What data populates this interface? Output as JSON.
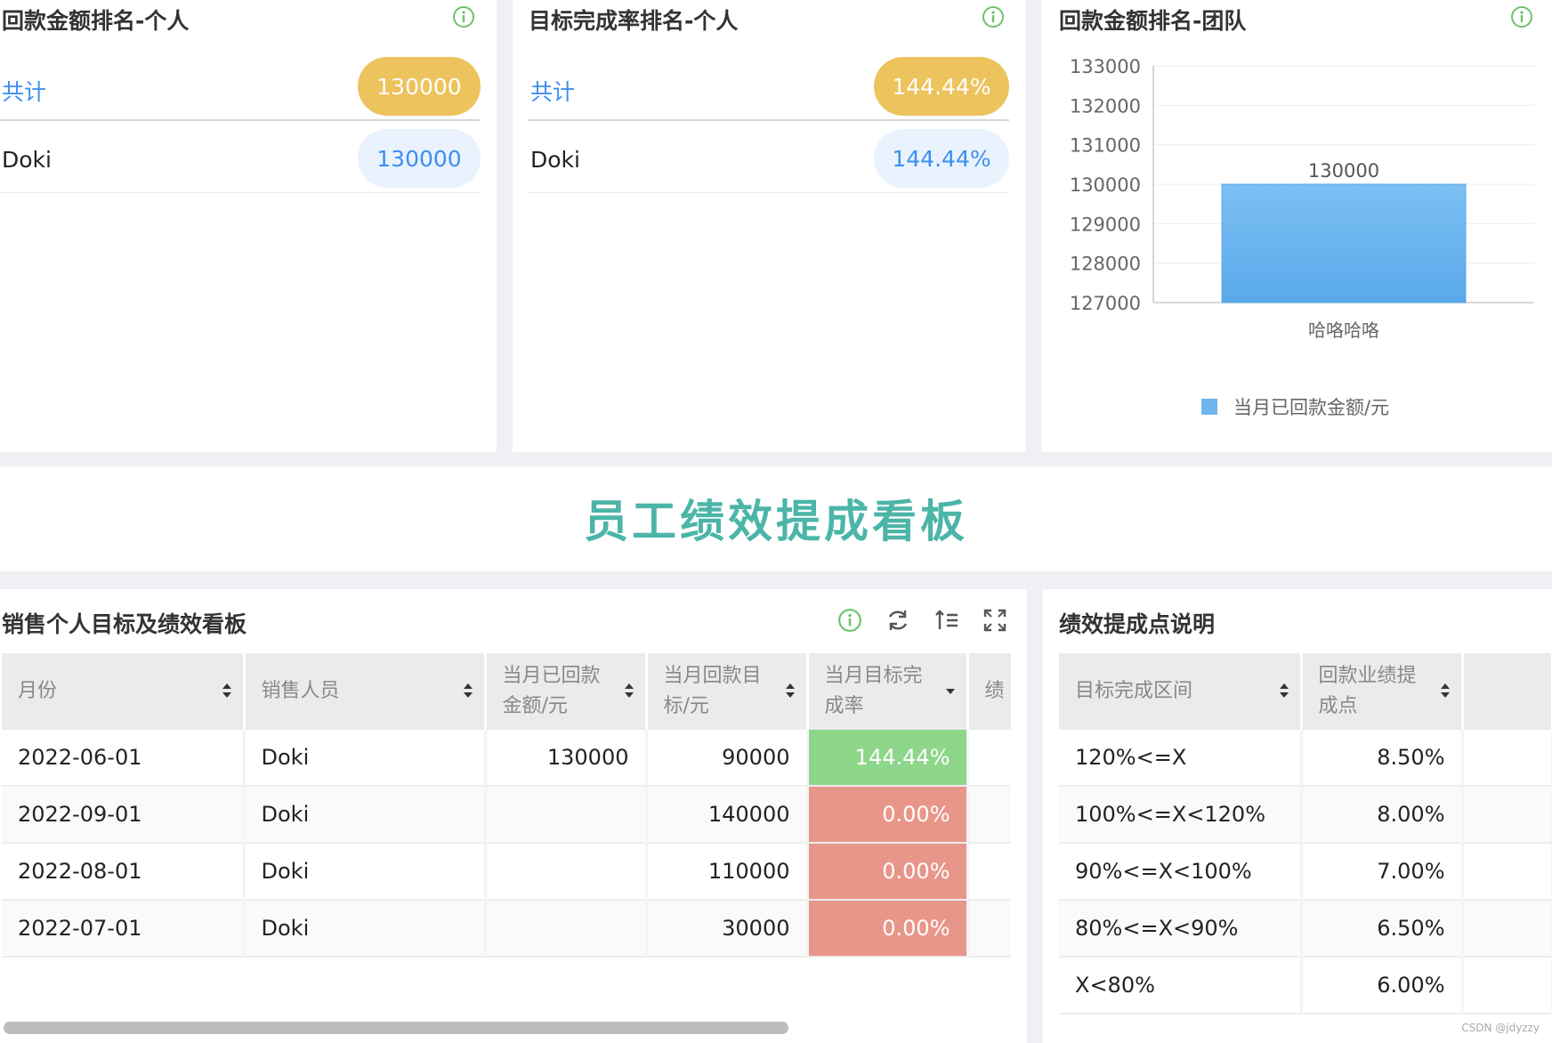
{
  "rank_personal_amount": {
    "title": "回款金额排名-个人",
    "total_label": "共计",
    "total_value": "130000",
    "rows": [
      {
        "name": "Doki",
        "value": "130000"
      }
    ]
  },
  "rank_personal_rate": {
    "title": "目标完成率排名-个人",
    "total_label": "共计",
    "total_value": "144.44%",
    "rows": [
      {
        "name": "Doki",
        "value": "144.44%"
      }
    ]
  },
  "rank_team": {
    "title": "回款金额排名-团队"
  },
  "chart_data": {
    "type": "bar",
    "categories": [
      "哈咯哈咯"
    ],
    "series": [
      {
        "name": "当月已回款金额/元",
        "values": [
          130000
        ]
      }
    ],
    "data_labels": [
      "130000"
    ],
    "ylim": [
      127000,
      133000
    ],
    "yticks": [
      "133000",
      "132000",
      "131000",
      "130000",
      "129000",
      "128000",
      "127000"
    ],
    "grid": true,
    "legend_position": "bottom",
    "bar_color": "#6fb4ef"
  },
  "banner": {
    "title": "员工绩效提成看板"
  },
  "sales_table": {
    "title": "销售个人目标及绩效看板",
    "columns": [
      "月份",
      "销售人员",
      "当月已回款金额/元",
      "当月回款目标/元",
      "当月目标完成率",
      "绩效"
    ],
    "column_wrapped": [
      [
        "月份"
      ],
      [
        "销售人员"
      ],
      [
        "当月已回款",
        "金额/元"
      ],
      [
        "当月回款目",
        "标/元"
      ],
      [
        "当月目标完",
        "成率"
      ],
      [
        "绩"
      ]
    ],
    "rows": [
      {
        "month": "2022-06-01",
        "person": "Doki",
        "received": "130000",
        "target": "90000",
        "rate": "144.44%",
        "status": "good"
      },
      {
        "month": "2022-09-01",
        "person": "Doki",
        "received": "",
        "target": "140000",
        "rate": "0.00%",
        "status": "bad"
      },
      {
        "month": "2022-08-01",
        "person": "Doki",
        "received": "",
        "target": "110000",
        "rate": "0.00%",
        "status": "bad"
      },
      {
        "month": "2022-07-01",
        "person": "Doki",
        "received": "",
        "target": "30000",
        "rate": "0.00%",
        "status": "bad"
      }
    ]
  },
  "commission_table": {
    "title": "绩效提成点说明",
    "columns_wrapped": [
      [
        "目标完成区间"
      ],
      [
        "回款业绩提",
        "成点"
      ]
    ],
    "rows": [
      {
        "range": "120%<=X",
        "point": "8.50%"
      },
      {
        "range": "100%<=X<120%",
        "point": "8.00%"
      },
      {
        "range": "90%<=X<100%",
        "point": "7.00%"
      },
      {
        "range": "80%<=X<90%",
        "point": "6.50%"
      },
      {
        "range": "X<80%",
        "point": "6.00%"
      }
    ]
  },
  "colors": {
    "accent": "#3d8ff0",
    "gold": "#ecc35d",
    "teal_title": "#4bb5a8",
    "green_rate": "#8ed68a",
    "red_rate": "#e8968a",
    "info_green": "#6cc36a"
  },
  "watermark": "CSDN @jdyzzy"
}
